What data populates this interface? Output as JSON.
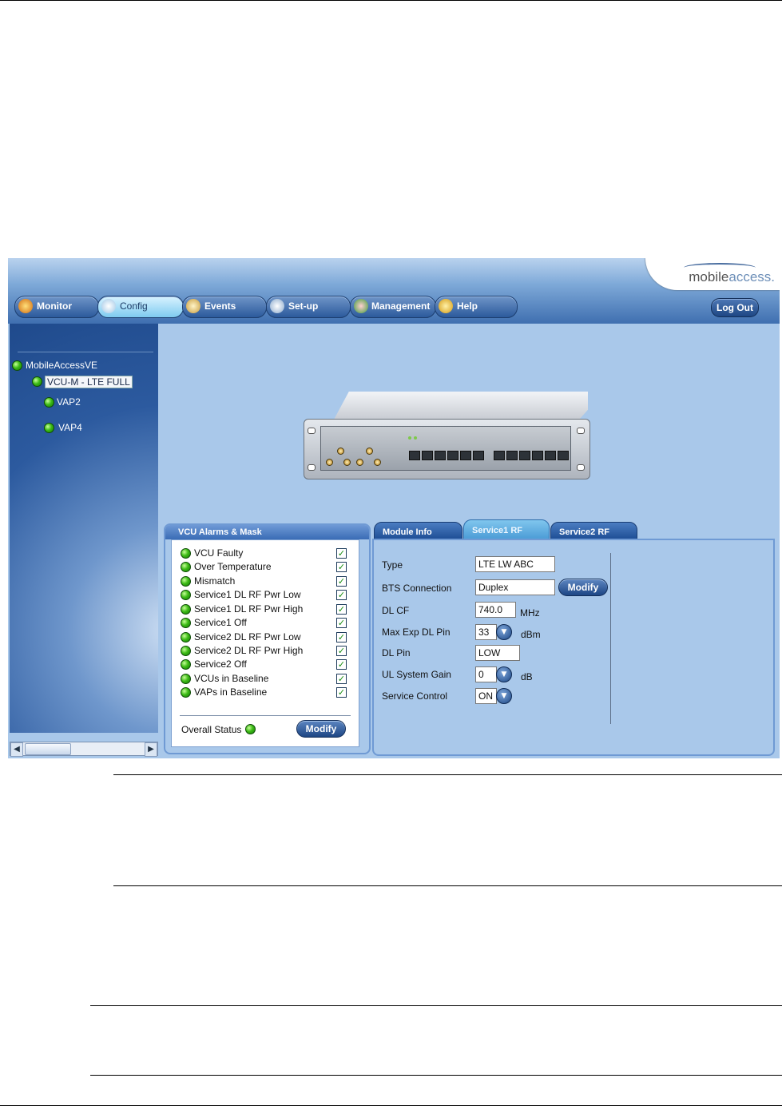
{
  "logo": {
    "prefix": "mobile",
    "suffix": "access."
  },
  "nav": {
    "tabs": [
      {
        "label": "Monitor",
        "icon": "monitor-icon"
      },
      {
        "label": "Config",
        "icon": "wrench-icon"
      },
      {
        "label": "Events",
        "icon": "events-icon"
      },
      {
        "label": "Set-up",
        "icon": "setup-icon"
      },
      {
        "label": "Management",
        "icon": "management-icon"
      },
      {
        "label": "Help",
        "icon": "help-icon"
      }
    ],
    "active_tab": "Config",
    "logout": "Log Out"
  },
  "tree": {
    "root": "MobileAccessVE",
    "selected": "VCU-M - LTE FULL",
    "children": [
      "VAP2",
      "VAP4"
    ]
  },
  "alarms": {
    "title": "VCU Alarms & Mask",
    "items": [
      {
        "label": "VCU Faulty",
        "checked": true
      },
      {
        "label": "Over Temperature",
        "checked": true
      },
      {
        "label": "Mismatch",
        "checked": true
      },
      {
        "label": "Service1 DL RF Pwr Low",
        "checked": true
      },
      {
        "label": "Service1 DL RF Pwr High",
        "checked": true
      },
      {
        "label": "Service1 Off",
        "checked": true
      },
      {
        "label": "Service2 DL RF Pwr Low",
        "checked": true
      },
      {
        "label": "Service2 DL RF Pwr High",
        "checked": true
      },
      {
        "label": "Service2 Off",
        "checked": true
      },
      {
        "label": "VCUs in Baseline",
        "checked": true
      },
      {
        "label": "VAPs in Baseline",
        "checked": true
      }
    ],
    "overall_label": "Overall Status",
    "modify_label": "Modify"
  },
  "service_tabs": {
    "tabs": [
      "Module Info",
      "Service1 RF",
      "Service2 RF"
    ],
    "active": "Service1 RF"
  },
  "service1": {
    "type_label": "Type",
    "type_value": "LTE LW ABC",
    "bts_label": "BTS Connection",
    "bts_value": "Duplex",
    "modify_label": "Modify",
    "dlcf_label": "DL CF",
    "dlcf_value": "740.0",
    "dlcf_unit": "MHz",
    "maxexp_label": "Max Exp DL Pin",
    "maxexp_value": "33",
    "maxexp_unit": "dBm",
    "dlpin_label": "DL Pin",
    "dlpin_value": "LOW",
    "ulgain_label": "UL System Gain",
    "ulgain_value": "0",
    "ulgain_unit": "dB",
    "svc_label": "Service Control",
    "svc_value": "ON"
  },
  "colors": {
    "accent": "#2c5a9c",
    "status_ok": "#3dbb16",
    "panel": "#a9c8ea"
  }
}
